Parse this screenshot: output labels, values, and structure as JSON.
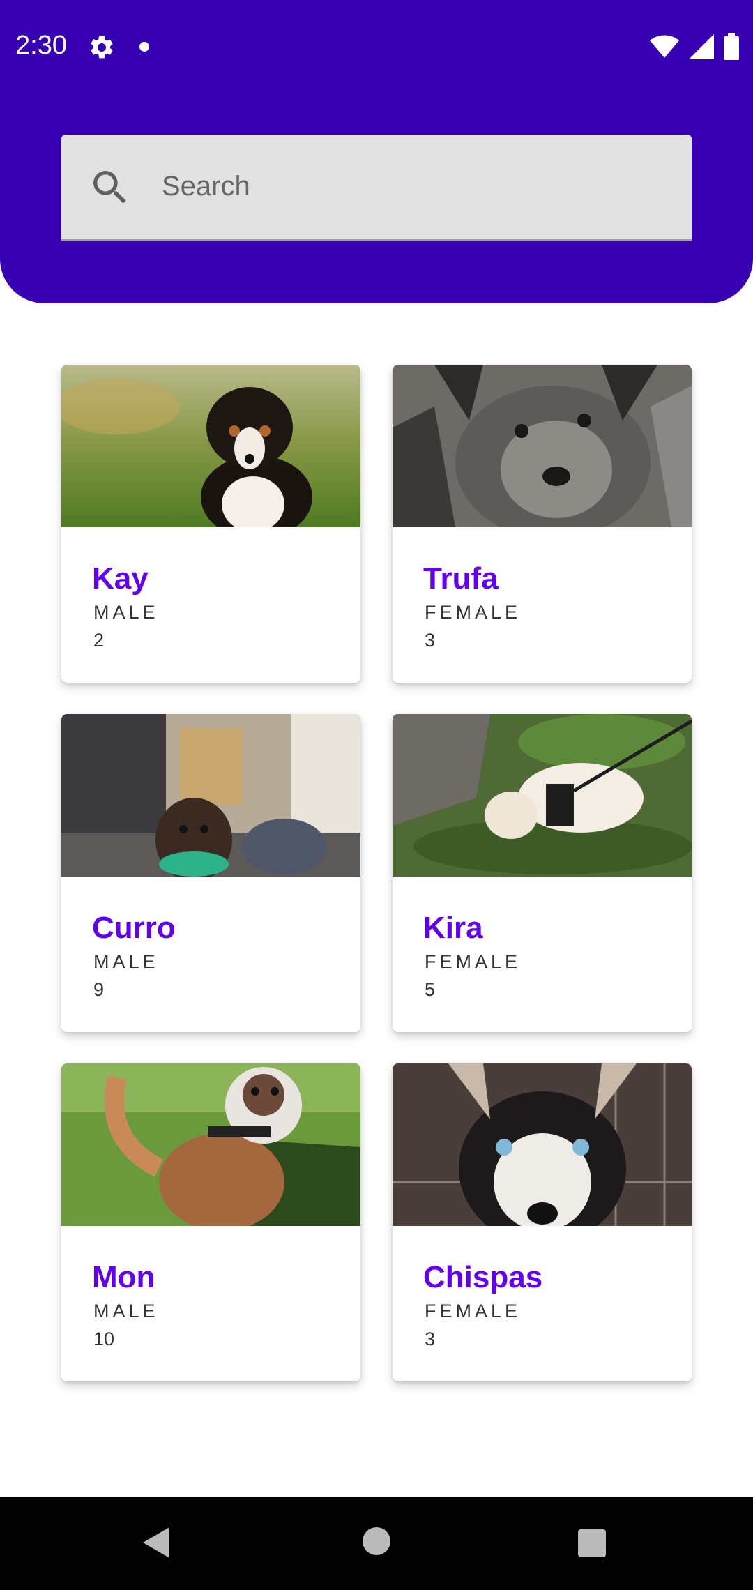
{
  "status_bar": {
    "time": "2:30"
  },
  "search": {
    "placeholder": "Search"
  },
  "pets": [
    {
      "name": "Kay",
      "gender": "MALE",
      "age": "2",
      "photo": "bernese-puppy-photo"
    },
    {
      "name": "Trufa",
      "gender": "FEMALE",
      "age": "3",
      "photo": "gray-dog-photo"
    },
    {
      "name": "Curro",
      "gender": "MALE",
      "age": "9",
      "photo": "spaniel-room-photo"
    },
    {
      "name": "Kira",
      "gender": "FEMALE",
      "age": "5",
      "photo": "white-dog-grass-photo"
    },
    {
      "name": "Mon",
      "gender": "MALE",
      "age": "10",
      "photo": "husky-mix-yard-photo"
    },
    {
      "name": "Chispas",
      "gender": "FEMALE",
      "age": "3",
      "photo": "husky-blue-eyes-photo"
    }
  ],
  "colors": {
    "header": "#3700b3",
    "accent": "#6200ee"
  }
}
